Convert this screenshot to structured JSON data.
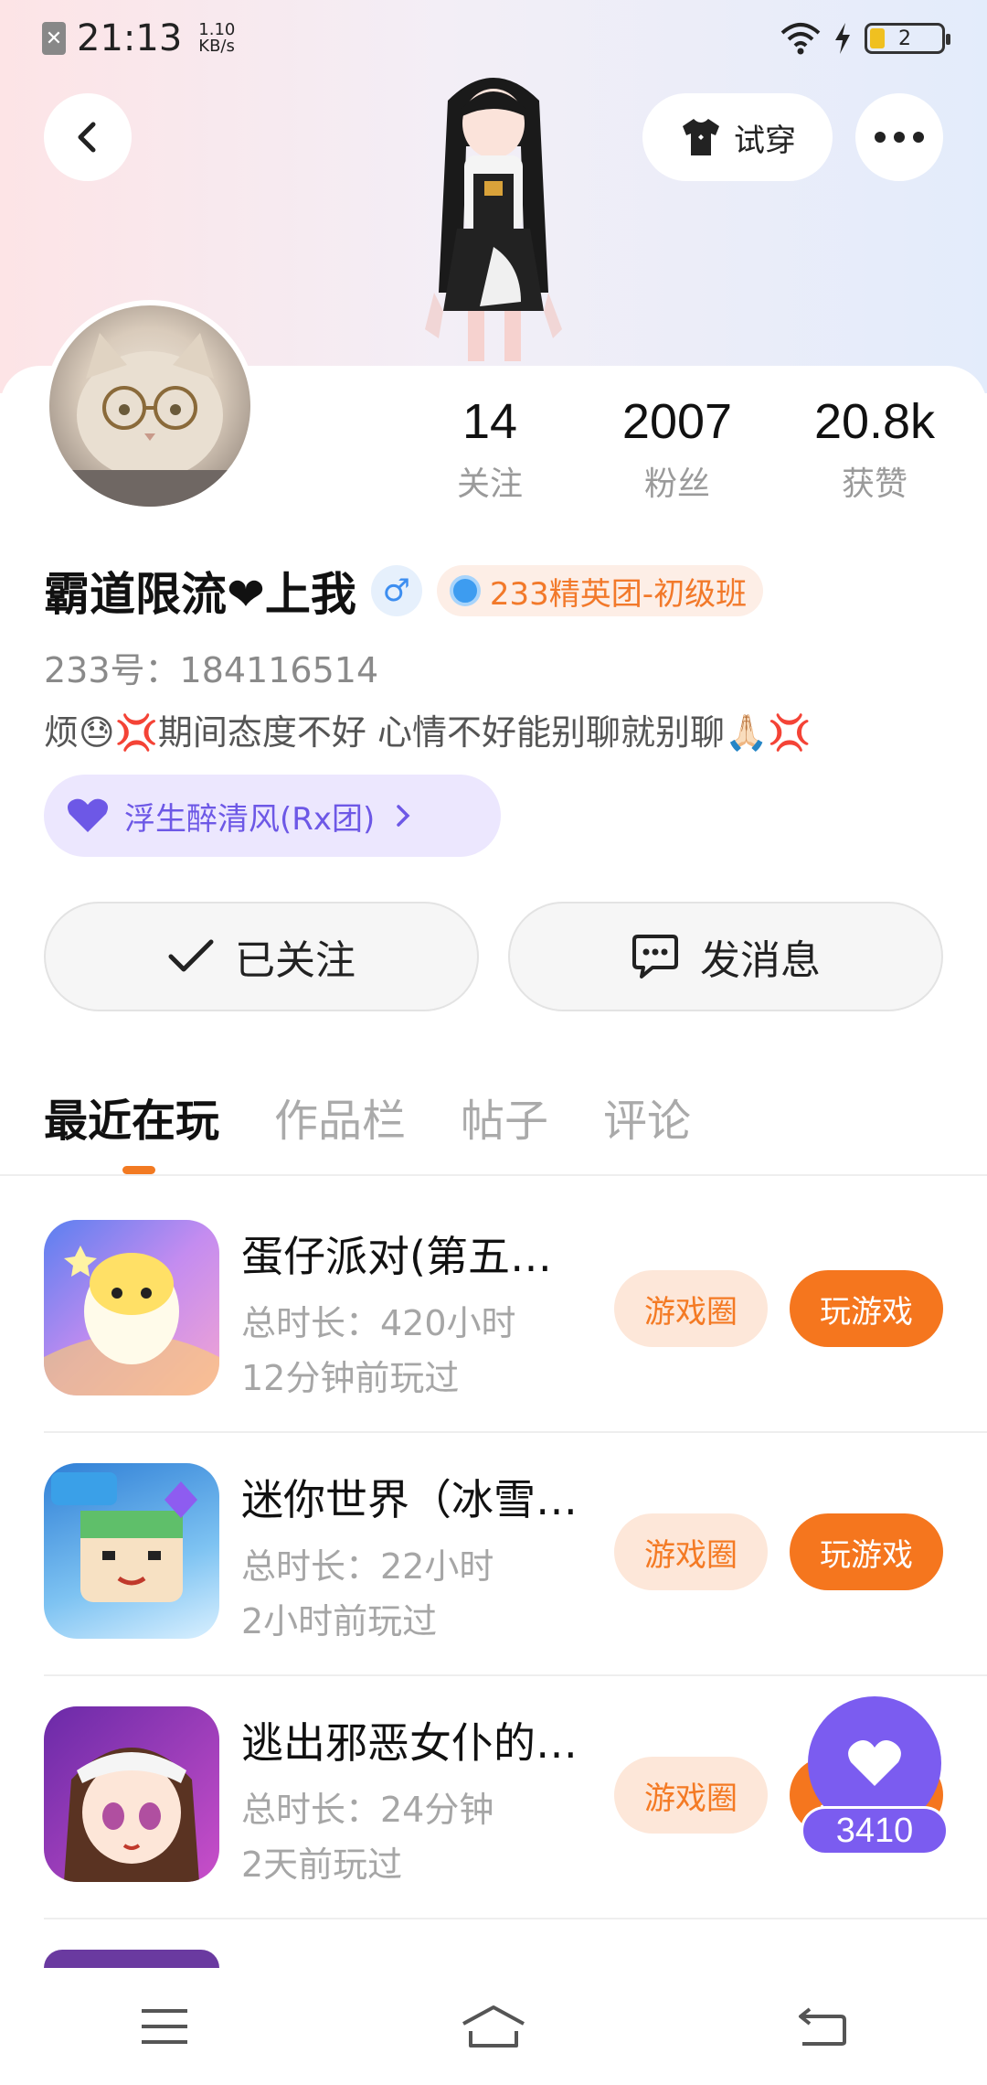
{
  "status_bar": {
    "time": "21:13",
    "net_speed_value": "1.10",
    "net_speed_unit": "KB/s",
    "battery_level": "2"
  },
  "header": {
    "try_on_label": "试穿"
  },
  "profile": {
    "stats": [
      {
        "value": "14",
        "label": "关注"
      },
      {
        "value": "2007",
        "label": "粉丝"
      },
      {
        "value": "20.8k",
        "label": "获赞"
      }
    ],
    "username": "霸道限流❤上我",
    "gender_symbol": "♂",
    "elite_badge": "233精英团-初级班",
    "uid": "233号：184116514",
    "bio": "烦😓💢期间态度不好 心情不好能别聊就别聊🙏🏻💢",
    "group": "浮生醉清风(Rx团)"
  },
  "actions": {
    "followed_label": "已关注",
    "message_label": "发消息"
  },
  "tabs": [
    "最近在玩",
    "作品栏",
    "帖子",
    "评论"
  ],
  "games": [
    {
      "title": "蛋仔派对(第五…",
      "duration": "总时长：420小时",
      "last_played": "12分钟前玩过",
      "circle_label": "游戏圈",
      "play_label": "玩游戏"
    },
    {
      "title": "迷你世界（冰雪…",
      "duration": "总时长：22小时",
      "last_played": "2小时前玩过",
      "circle_label": "游戏圈",
      "play_label": "玩游戏"
    },
    {
      "title": "逃出邪恶女仆的…",
      "duration": "总时长：24分钟",
      "last_played": "2天前玩过",
      "circle_label": "游戏圈",
      "play_label": "玩游戏"
    }
  ],
  "like_count": "3410",
  "colors": {
    "accent_orange": "#f5761e",
    "accent_purple": "#7b5cf0"
  }
}
